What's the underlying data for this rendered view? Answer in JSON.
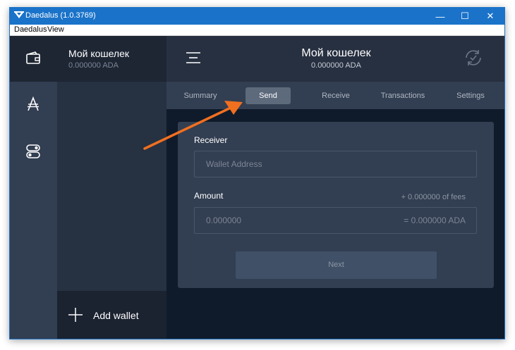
{
  "window": {
    "title": "Daedalus (1.0.3769)",
    "controls": {
      "minimize": "—",
      "maximize": "☐",
      "close": "✕"
    }
  },
  "menu": {
    "items": [
      "Daedalus",
      "View"
    ]
  },
  "rail": {
    "icons": [
      "wallet-icon",
      "ada-icon",
      "settings-toggle-icon"
    ]
  },
  "wallet_list": {
    "active_wallet": {
      "name": "Мой кошелек",
      "balance": "0.000000 ADA"
    },
    "add_wallet_label": "Add wallet"
  },
  "header": {
    "wallet_name": "Мой кошелек",
    "balance": "0.000000 ADA",
    "sync_icon": "sync-check-icon"
  },
  "tabs": [
    {
      "label": "Summary",
      "active": false
    },
    {
      "label": "Send",
      "active": true
    },
    {
      "label": "Receive",
      "active": false
    },
    {
      "label": "Transactions",
      "active": false
    },
    {
      "label": "Settings",
      "active": false
    }
  ],
  "send_form": {
    "receiver_label": "Receiver",
    "receiver_placeholder": "Wallet Address",
    "amount_label": "Amount",
    "fees_text": "+ 0.000000 of fees",
    "amount_placeholder": "0.000000",
    "amount_total": "= 0.000000 ADA",
    "next_label": "Next"
  },
  "colors": {
    "titlebar": "#1a73c9",
    "rail": "#323e51",
    "main_bg": "#0f1b2a",
    "card": "#323e51",
    "annotation_arrow": "#f07020"
  },
  "annotation": {
    "type": "arrow",
    "points_to": "tabs.1"
  }
}
